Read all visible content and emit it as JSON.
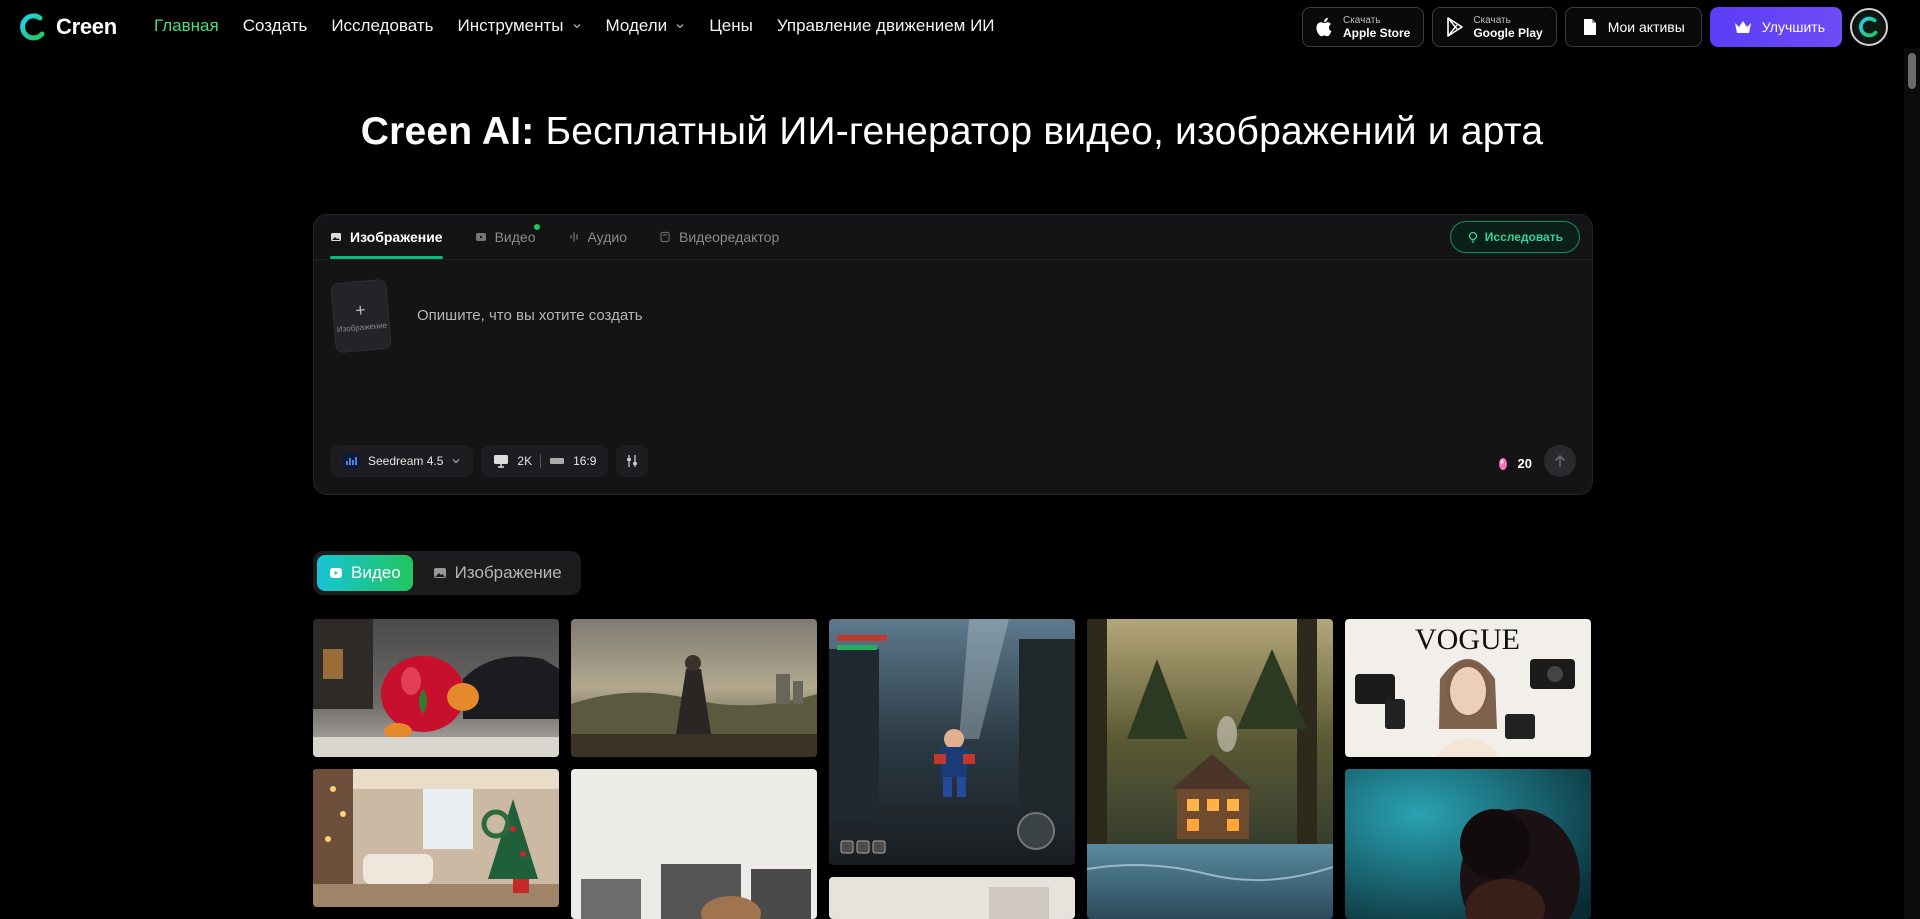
{
  "brand": {
    "name": "Creen"
  },
  "nav": {
    "links": [
      {
        "label": "Главная",
        "active": true,
        "dropdown": false
      },
      {
        "label": "Создать",
        "active": false,
        "dropdown": false
      },
      {
        "label": "Исследовать",
        "active": false,
        "dropdown": false
      },
      {
        "label": "Инструменты",
        "active": false,
        "dropdown": true
      },
      {
        "label": "Модели",
        "active": false,
        "dropdown": true
      },
      {
        "label": "Цены",
        "active": false,
        "dropdown": false
      },
      {
        "label": "Управление движением ИИ",
        "active": false,
        "dropdown": false
      }
    ],
    "apple": {
      "small": "Скачать",
      "big": "Apple Store"
    },
    "google": {
      "small": "Скачать",
      "big": "Google Play"
    },
    "assets_label": "Мои активы",
    "upgrade_label": "Улучшить"
  },
  "hero": {
    "title_brand": "Creen AI:",
    "title_rest": " Бесплатный ИИ-генератор видео, изображений и арта"
  },
  "generator": {
    "tabs": [
      {
        "label": "Изображение",
        "icon": "image-icon",
        "active": true
      },
      {
        "label": "Видео",
        "icon": "video-icon",
        "active": false,
        "new_dot": true
      },
      {
        "label": "Аудио",
        "icon": "audio-icon",
        "active": false
      },
      {
        "label": "Видеоредактор",
        "icon": "editor-icon",
        "active": false
      }
    ],
    "explore_label": "Исследовать",
    "upload_label": "Изображение",
    "prompt_placeholder": "Опишите, что вы хотите создать",
    "model": "Seedream 4.5",
    "resolution": "2K",
    "aspect": "16:9",
    "credits": "20"
  },
  "media_toggle": {
    "video": "Видео",
    "image": "Изображение",
    "active": "video"
  },
  "colors": {
    "accent_green": "#4ade80",
    "upgrade_purple": "#5b3df5",
    "toggle_gradient_start": "#16c4d6",
    "toggle_gradient_end": "#22c55e"
  },
  "gallery": [
    {
      "name": "tile-cat-tomato"
    },
    {
      "name": "tile-knight-landscape"
    },
    {
      "name": "tile-game-runner"
    },
    {
      "name": "tile-forest-cabin"
    },
    {
      "name": "tile-vogue-cover"
    },
    {
      "name": "tile-christmas-room"
    },
    {
      "name": "tile-gallery-woman"
    },
    {
      "name": "tile-kitchen"
    },
    {
      "name": "tile-neon-portrait"
    }
  ]
}
